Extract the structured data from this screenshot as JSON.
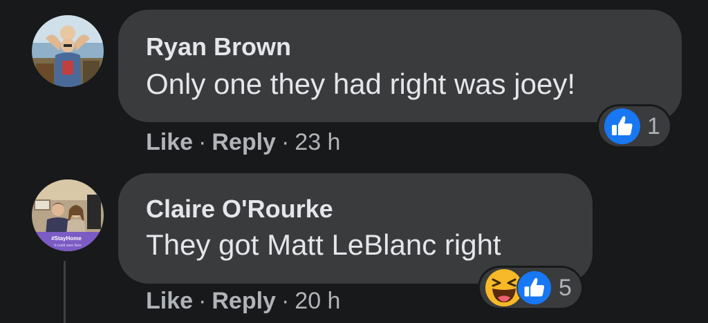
{
  "comments": [
    {
      "author": "Ryan Brown",
      "text": "Only one they had right was joey!",
      "actions": {
        "like": "Like",
        "reply": "Reply",
        "separator": "·",
        "time": "23 h"
      },
      "reactions": {
        "icons": [
          "like-icon"
        ],
        "count": "1"
      }
    },
    {
      "author": "Claire O'Rourke",
      "text": "They got Matt LeBlanc right",
      "actions": {
        "like": "Like",
        "reply": "Reply",
        "separator": "·",
        "time": "20 h"
      },
      "reactions": {
        "icons": [
          "haha-icon",
          "like-icon"
        ],
        "count": "5"
      },
      "avatar_overlay": {
        "line1": "#StayHome",
        "line2": "it could save lives"
      }
    }
  ],
  "colors": {
    "background": "#18191a",
    "bubble": "#3a3b3c",
    "primary_text": "#e4e6eb",
    "secondary_text": "#b0b3b8",
    "like_blue": "#1877f2",
    "haha_yellow": "#f7b928",
    "stayhome_purple": "#7b5bc4"
  }
}
